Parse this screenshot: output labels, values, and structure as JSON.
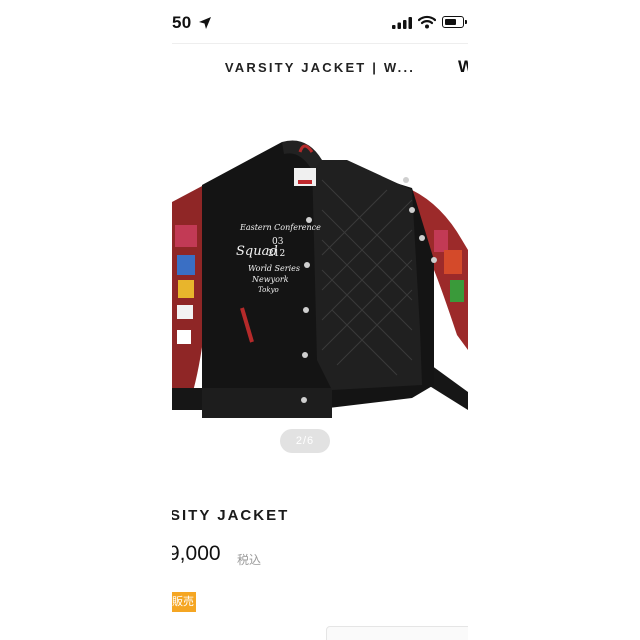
{
  "status_bar": {
    "time": "50",
    "battery_level": 0.7,
    "icons": [
      "location-arrow-icon",
      "signal-icon",
      "wifi-icon",
      "battery-icon"
    ]
  },
  "header": {
    "title": "VARSITY JACKET | W...",
    "right_glyph": "W"
  },
  "gallery": {
    "page_indicator": "2/6",
    "patch_text": {
      "line1": "Eastern Conference",
      "line2": "Squad",
      "num1": "03",
      "num2": "212",
      "line3": "World Series",
      "line4": "Newyork",
      "line5": "Tokyo"
    }
  },
  "product": {
    "name": "SITY JACKET",
    "price": "9,000",
    "tax_label": "税込",
    "status_badge": "販売"
  },
  "colors": {
    "badge": "#f5a623",
    "sleeve": "#9c2a2a",
    "body": "#141414"
  }
}
